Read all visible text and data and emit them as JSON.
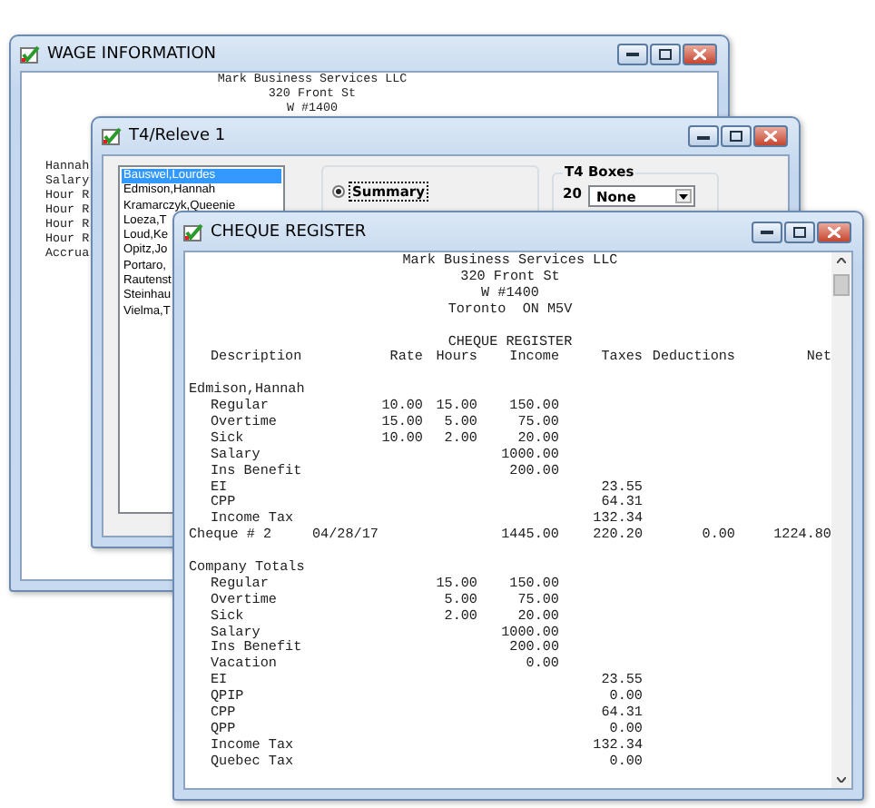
{
  "windows": [
    {
      "kind": "wage",
      "title": "WAGE INFORMATION",
      "header_lines": [
        "Mark Business Services LLC",
        "320 Front St",
        "W #1400"
      ],
      "detail_lines": [
        "Hannah",
        "Salary",
        "Hour R",
        "Hour R",
        "Hour R",
        "Hour R",
        "Accrua"
      ]
    },
    {
      "kind": "t4",
      "title": "T4/Releve 1",
      "employees": [
        {
          "name": "Bauswel,Lourdes",
          "selected": true
        },
        {
          "name": "Edmison,Hannah",
          "selected": false
        },
        {
          "name": "Kramarczyk,Queenie",
          "selected": false
        },
        {
          "name": "Loeza,T",
          "selected": false
        },
        {
          "name": "Loud,Ke",
          "selected": false
        },
        {
          "name": "Opitz,Jo",
          "selected": false
        },
        {
          "name": "Portaro,",
          "selected": false
        },
        {
          "name": "Rautenst",
          "selected": false
        },
        {
          "name": "Steinhau",
          "selected": false
        },
        {
          "name": "Vielma,T",
          "selected": false
        }
      ],
      "options": [
        {
          "label": "Summary",
          "selected": true
        }
      ],
      "box_group": {
        "legend": "T4 Boxes",
        "box_number": "20",
        "box_value": "None"
      }
    },
    {
      "kind": "cheque",
      "title": "CHEQUE REGISTER",
      "report": {
        "header_lines": [
          "Mark Business Services LLC",
          "320 Front St",
          "W #1400",
          "Toronto  ON M5V"
        ],
        "title": "CHEQUE REGISTER",
        "columns": [
          "Description",
          "Rate",
          "Hours",
          "Income",
          "Taxes",
          "Deductions",
          "Net"
        ],
        "sections": [
          {
            "heading": "Edmison,Hannah",
            "items": [
              {
                "description": "Regular",
                "rate": "10.00",
                "hours": "15.00",
                "income": "150.00"
              },
              {
                "description": "Overtime",
                "rate": "15.00",
                "hours": "5.00",
                "income": "75.00"
              },
              {
                "description": "Sick",
                "rate": "10.00",
                "hours": "2.00",
                "income": "20.00"
              },
              {
                "description": "Salary",
                "income": "1000.00"
              },
              {
                "description": "Ins Benefit",
                "income": "200.00"
              },
              {
                "description": "EI",
                "taxes": "23.55"
              },
              {
                "description": "CPP",
                "taxes": "64.31"
              },
              {
                "description": "Income Tax",
                "taxes": "132.34"
              }
            ],
            "summary": {
              "description": "Cheque # 2",
              "date": "04/28/17",
              "income": "1445.00",
              "taxes": "220.20",
              "deductions": "0.00",
              "net": "1224.80"
            }
          },
          {
            "heading": "Company Totals",
            "items": [
              {
                "description": "Regular",
                "hours": "15.00",
                "income": "150.00"
              },
              {
                "description": "Overtime",
                "hours": "5.00",
                "income": "75.00"
              },
              {
                "description": "Sick",
                "hours": "2.00",
                "income": "20.00"
              },
              {
                "description": "Salary",
                "income": "1000.00"
              },
              {
                "description": "Ins Benefit",
                "income": "200.00"
              },
              {
                "description": "Vacation",
                "income": "0.00"
              },
              {
                "description": "EI",
                "taxes": "23.55"
              },
              {
                "description": "QPIP",
                "taxes": "0.00"
              },
              {
                "description": "CPP",
                "taxes": "64.31"
              },
              {
                "description": "QPP",
                "taxes": "0.00"
              },
              {
                "description": "Income Tax",
                "taxes": "132.34"
              },
              {
                "description": "Quebec Tax",
                "taxes": "0.00"
              }
            ]
          }
        ]
      }
    }
  ]
}
